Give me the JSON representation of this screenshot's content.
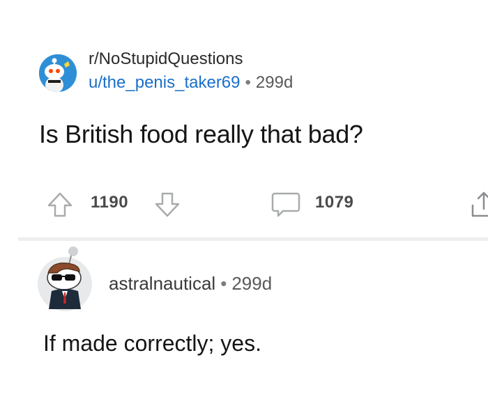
{
  "post": {
    "subreddit": "r/NoStupidQuestions",
    "author": "u/the_penis_taker69",
    "separator": "•",
    "age": "299d",
    "title": "Is British food really that bad?"
  },
  "actions": {
    "upvotes": "1190",
    "comments": "1079"
  },
  "comment": {
    "author": "astralnautical",
    "separator": "•",
    "age": "299d",
    "body": "If made correctly; yes."
  },
  "icons": {
    "upvote": "arrow-up-icon",
    "downvote": "arrow-down-icon",
    "comments": "speech-bubble-icon",
    "share": "share-icon"
  },
  "colors": {
    "author_link": "#1a6fc9",
    "subreddit_avatar_bg": "#2f8fd6",
    "icon_stroke": "#a8aaab",
    "divider": "#eceef0"
  }
}
